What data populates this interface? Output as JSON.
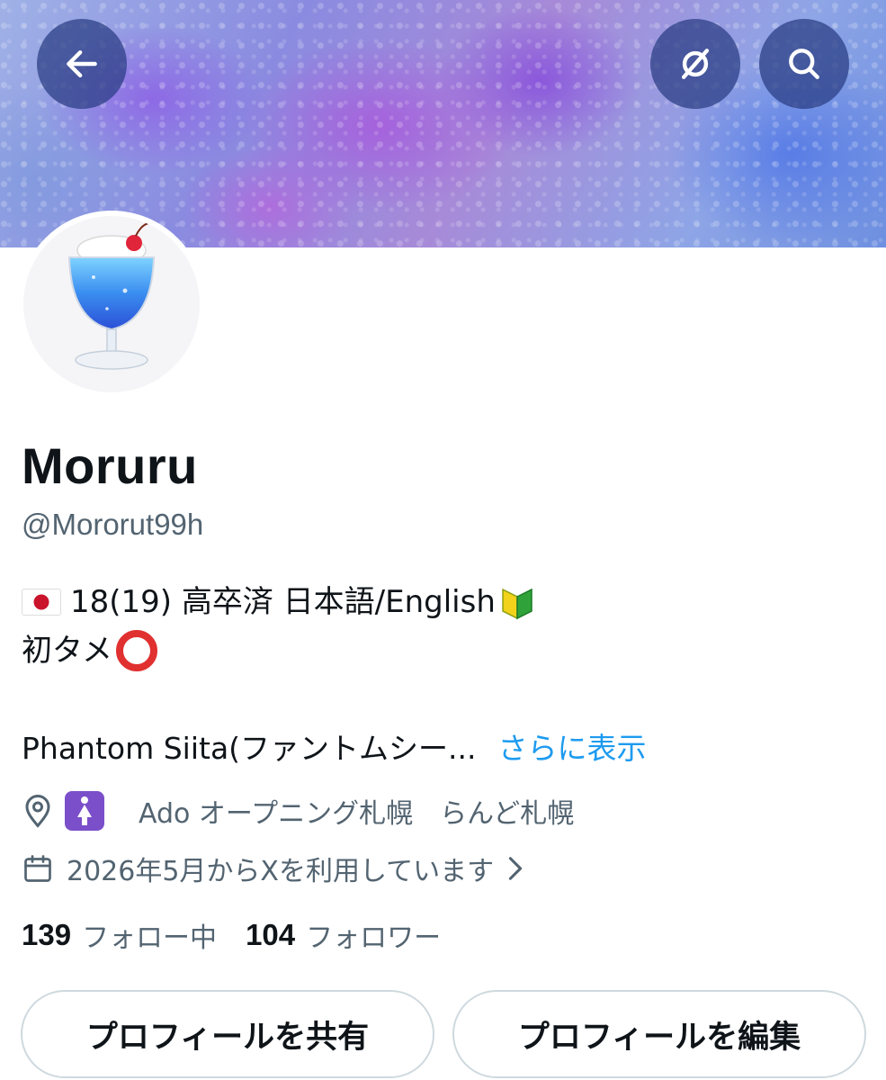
{
  "header": {
    "back_icon": "arrow-left-icon",
    "grok_icon": "grok-icon",
    "search_icon": "search-icon"
  },
  "profile": {
    "display_name": "Moruru",
    "handle": "@Mororut99h",
    "bio_line1_text": "18(19) 高卒済 日本語/English",
    "bio_line2_text": "初タメ",
    "extended_text": "Phantom Siita(ファントムシー...",
    "show_more": "さらに表示",
    "location": "Ado オープニング札幌　らんど札幌",
    "joined": "2026年5月からXを利用しています",
    "following_count": "139",
    "following_label": "フォロー中",
    "followers_count": "104",
    "followers_label": "フォロワー"
  },
  "actions": {
    "share_label": "プロフィールを共有",
    "edit_label": "プロフィールを編集"
  },
  "colors": {
    "text": "#0f1419",
    "secondary": "#536471",
    "link": "#1d9bf0",
    "border": "#cfd9de"
  }
}
